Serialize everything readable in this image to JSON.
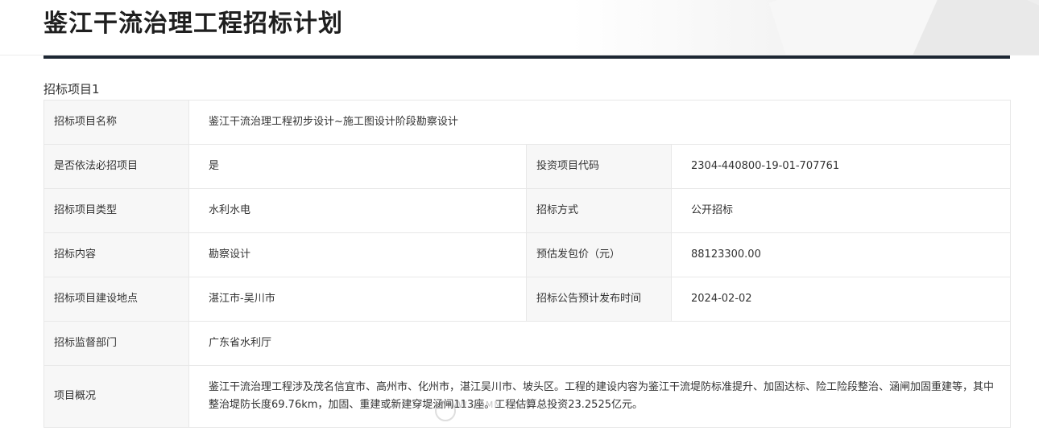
{
  "header": {
    "title": "鉴江干流治理工程招标计划"
  },
  "section": {
    "title": "招标项目1"
  },
  "rows": {
    "project_name": {
      "label": "招标项目名称",
      "value": "鉴江干流治理工程初步设计~施工图设计阶段勘察设计"
    },
    "mandatory": {
      "label": "是否依法必招项目",
      "value": "是"
    },
    "invest_code": {
      "label": "投资项目代码",
      "value": "2304-440800-19-01-707761"
    },
    "project_type": {
      "label": "招标项目类型",
      "value": "水利水电"
    },
    "bid_method": {
      "label": "招标方式",
      "value": "公开招标"
    },
    "content": {
      "label": "招标内容",
      "value": "勘察设计"
    },
    "est_price": {
      "label": "预估发包价（元）",
      "value": "88123300.00"
    },
    "location": {
      "label": "招标项目建设地点",
      "value": "湛江市-吴川市"
    },
    "publish_time": {
      "label": "招标公告预计发布时间",
      "value": "2024-02-02"
    },
    "supervisor": {
      "label": "招标监督部门",
      "value": "广东省水利厅"
    },
    "overview": {
      "label": "项目概况",
      "value": "鉴江干流治理工程涉及茂名信宜市、高州市、化州市，湛江吴川市、坡头区。工程的建设内容为鉴江干流堤防标准提升、加固达标、险工险段整治、涵闸加固重建等，其中整治堤防长度69.76km，加固、重建或新建穿堤涵闸113座。工程估算总投资23.2525亿元。"
    }
  },
  "watermark": {
    "text": "WWW.GDMM.COM"
  }
}
